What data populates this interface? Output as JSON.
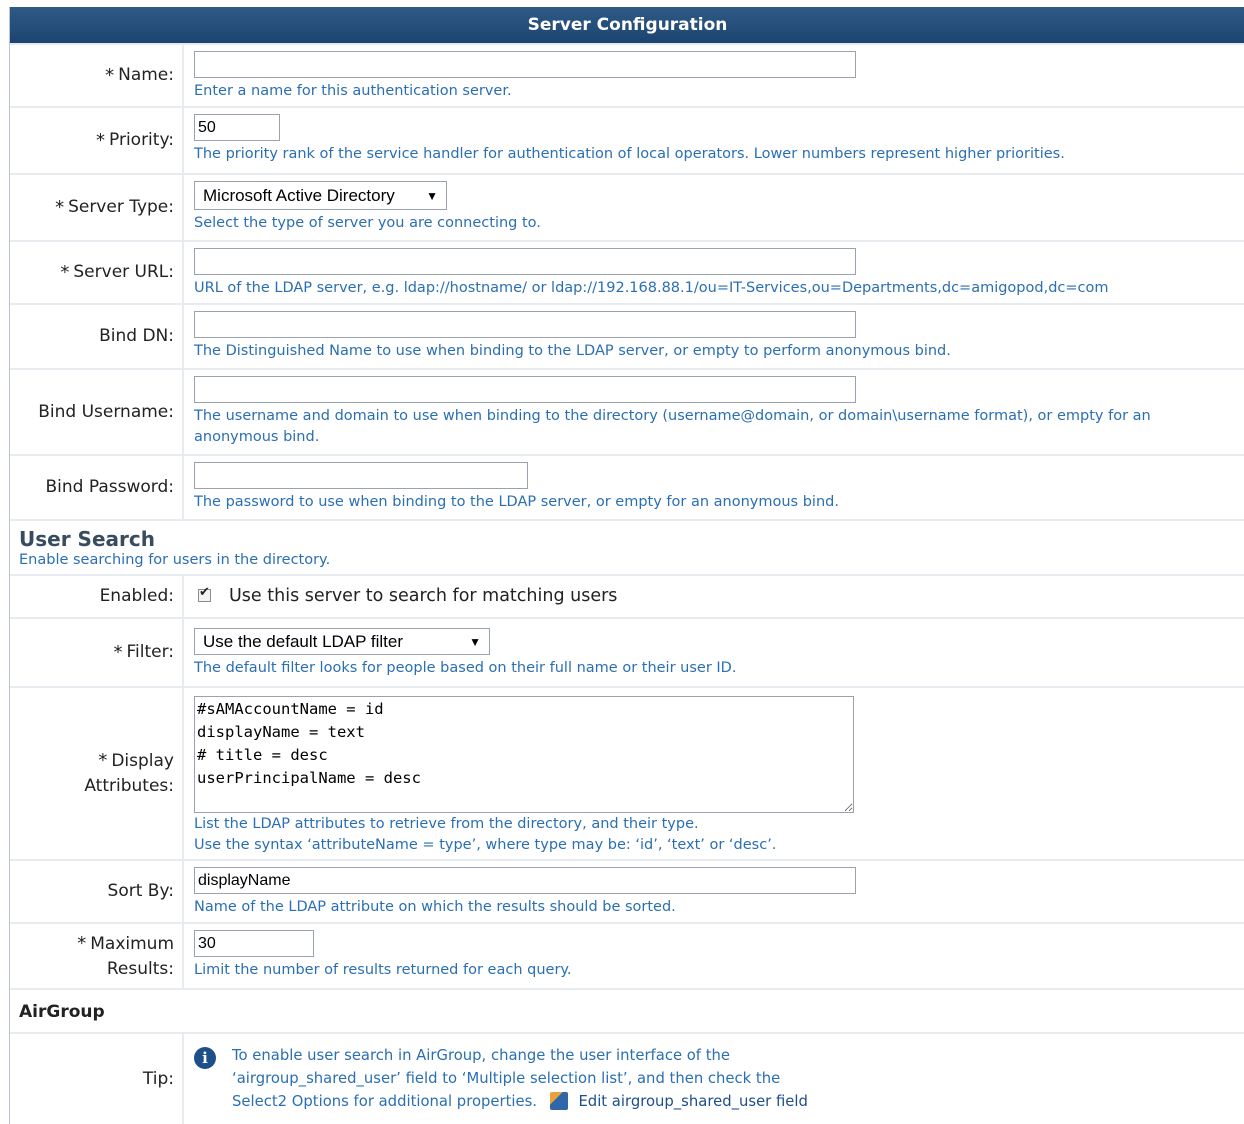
{
  "header": {
    "title": "Server Configuration"
  },
  "fields": {
    "name": {
      "label": "Name:",
      "value": "",
      "hint": "Enter a name for this authentication server."
    },
    "priority": {
      "label": "Priority:",
      "value": "50",
      "hint": "The priority rank of the service handler for authentication of local operators. Lower numbers represent higher priorities."
    },
    "server_type": {
      "label": "Server Type:",
      "selected": "Microsoft Active Directory",
      "hint": "Select the type of server you are connecting to."
    },
    "server_url": {
      "label": "Server URL:",
      "value": "",
      "hint": "URL of the LDAP server, e.g. ldap://hostname/ or ldap://192.168.88.1/ou=IT-Services,ou=Departments,dc=amigopod,dc=com"
    },
    "bind_dn": {
      "label": "Bind DN:",
      "value": "",
      "hint": "The Distinguished Name to use when binding to the LDAP server, or empty to perform anonymous bind."
    },
    "bind_username": {
      "label": "Bind Username:",
      "value": "",
      "hint": "The username and domain to use when binding to the directory (username@domain, or domain\\username format), or empty for an anonymous bind."
    },
    "bind_password": {
      "label": "Bind Password:",
      "value": "",
      "hint": "The password to use when binding to the LDAP server, or empty for an anonymous bind."
    }
  },
  "user_search": {
    "title": "User Search",
    "desc": "Enable searching for users in the directory.",
    "enabled": {
      "label": "Enabled:",
      "checked": true,
      "text": "Use this server to search for matching users"
    },
    "filter": {
      "label": "Filter:",
      "selected": "Use the default LDAP filter",
      "hint": "The default filter looks for people based on their full name or their user ID."
    },
    "display_attributes": {
      "label_line1": "Display",
      "label_line2": "Attributes:",
      "value": "#sAMAccountName = id\ndisplayName = text\n# title = desc\nuserPrincipalName = desc",
      "hint_line1": "List the LDAP attributes to retrieve from the directory, and their type.",
      "hint_line2": "Use the syntax ‘attributeName = type’, where type may be: ‘id’, ‘text’ or ‘desc’."
    },
    "sort_by": {
      "label": "Sort By:",
      "value": "displayName",
      "hint": "Name of the LDAP attribute on which the results should be sorted."
    },
    "max_results": {
      "label_line1": "Maximum",
      "label_line2": "Results:",
      "value": "30",
      "hint": "Limit the number of results returned for each query."
    }
  },
  "airgroup": {
    "title": "AirGroup",
    "tip_label": "Tip:",
    "tip_line1": "To enable user search in AirGroup, change the user interface of the",
    "tip_line2": "‘airgroup_shared_user’ field to ‘Multiple selection list’, and then check the",
    "tip_line3": "Select2 Options for additional properties.",
    "edit_link": "Edit airgroup_shared_user field"
  },
  "required_marker": "*",
  "icons": {
    "info": "info-icon",
    "edit": "edit-field-icon",
    "dropdown": "chevron-down-icon"
  },
  "colors": {
    "header": "#1d4470",
    "hint": "#2a6fb3"
  }
}
